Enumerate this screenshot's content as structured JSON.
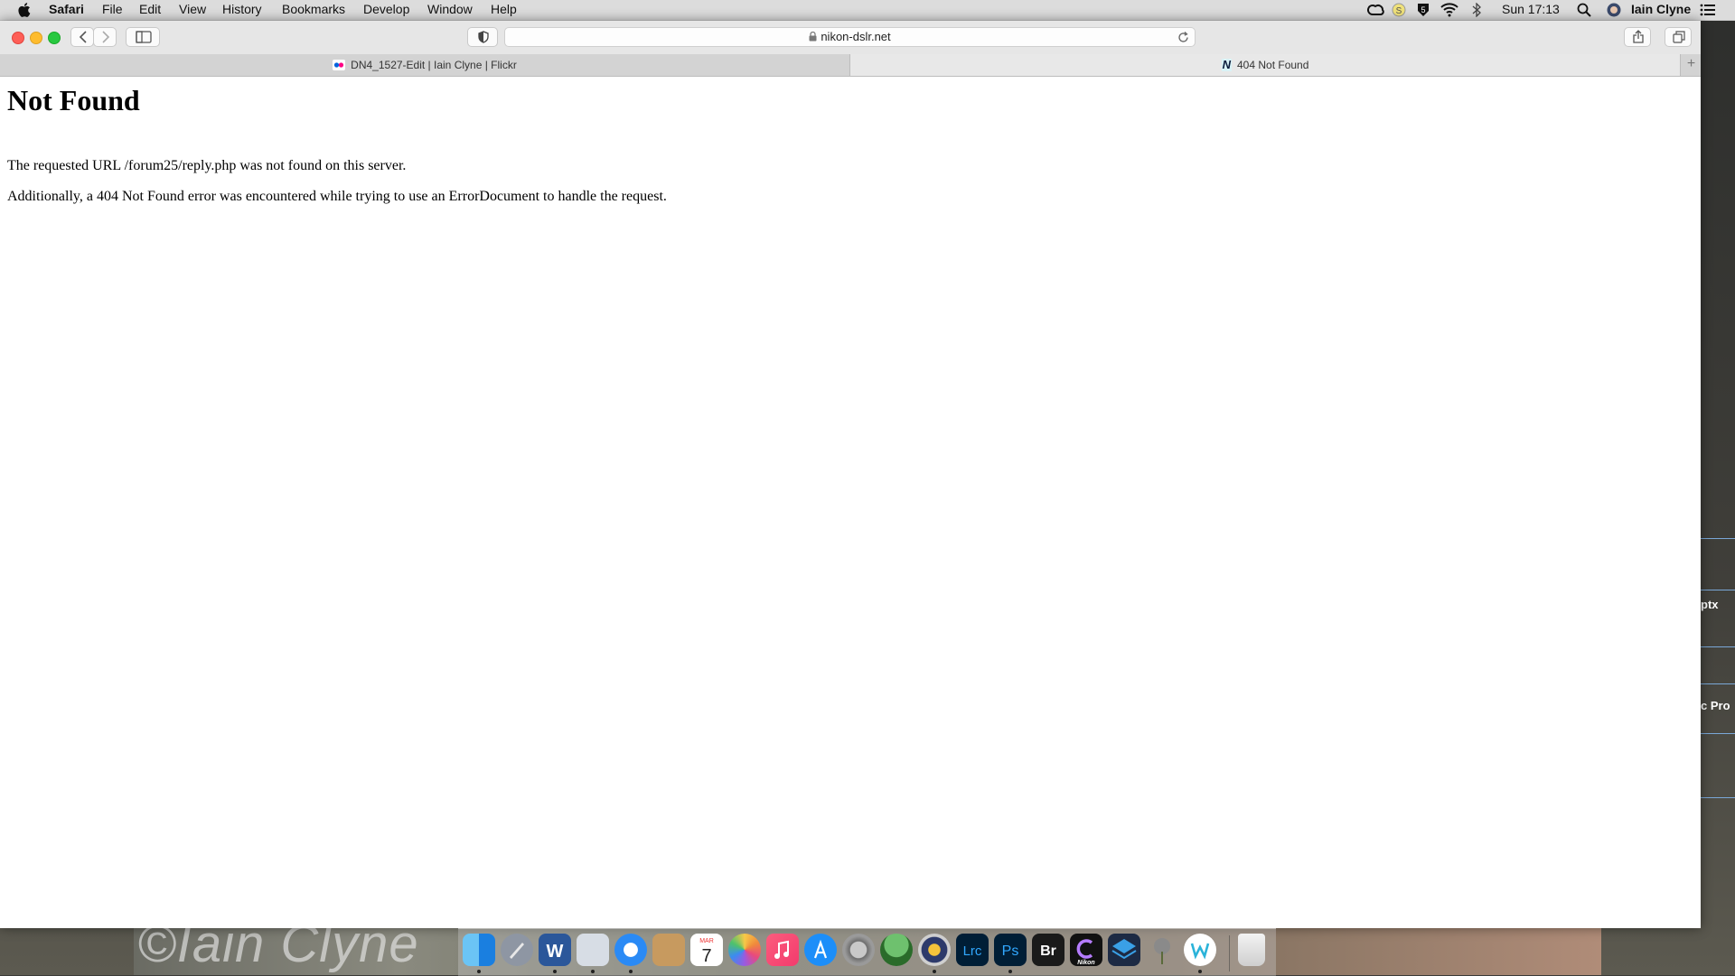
{
  "menubar": {
    "app_name": "Safari",
    "menus": [
      "File",
      "Edit",
      "View",
      "History",
      "Bookmarks",
      "Develop",
      "Window",
      "Help"
    ],
    "clock": "Sun 17:13",
    "user": "Iain Clyne"
  },
  "toolbar": {
    "url": "nikon-dslr.net"
  },
  "tabs": [
    {
      "title": "DN4_1527-Edit | Iain Clyne | Flickr",
      "active": false
    },
    {
      "title": "404 Not Found",
      "active": true
    }
  ],
  "tab_plus": "+",
  "page": {
    "heading": "Not Found",
    "line1": "The requested URL /forum25/reply.php was not found on this server.",
    "line2": "Additionally, a 404 Not Found error was encountered while trying to use an ErrorDocument to handle the request."
  },
  "desktop": {
    "watermark": "©Iain Clyne",
    "label_1": "ptx",
    "label_2": "c Pro"
  },
  "dock": {
    "apps": [
      "finder-icon",
      "launchpad-icon",
      "word-icon",
      "preview-icon",
      "safari-icon",
      "contacts-icon",
      "calendar-icon",
      "photos-icon",
      "music-icon",
      "app-store-icon",
      "system-preferences-icon",
      "turtle-app-icon",
      "settings-gear-icon",
      "lightroom-classic-icon",
      "photoshop-icon",
      "bridge-icon",
      "nikon-capture-icon",
      "layers-app-icon",
      "thistle-app-icon",
      "w-app-icon",
      "trash-icon"
    ],
    "calendar_month": "MAR",
    "calendar_day": "7",
    "lrc": "Lrc",
    "ps": "Ps",
    "br": "Br",
    "nikon": "Nikon"
  },
  "colors": {
    "close": "#fe5f57",
    "minimize": "#febc2e",
    "maximize": "#28c840",
    "photoshop": "#001e36",
    "lightroom": "#001e36"
  }
}
